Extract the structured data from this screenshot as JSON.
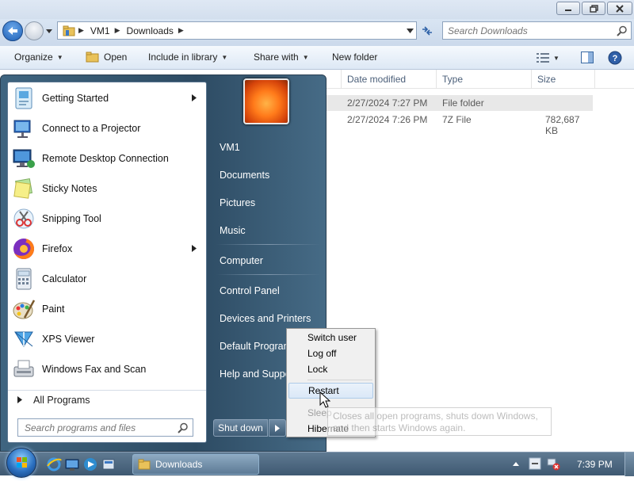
{
  "explorer": {
    "address": [
      "VM1",
      "Downloads"
    ],
    "search_placeholder": "Search Downloads",
    "toolbar": {
      "organize": "Organize",
      "open": "Open",
      "include": "Include in library",
      "share": "Share with",
      "new_folder": "New folder"
    },
    "columns": {
      "date": "Date modified",
      "type": "Type",
      "size": "Size"
    },
    "files": [
      {
        "date": "2/27/2024 7:27 PM",
        "type": "File folder",
        "size": ""
      },
      {
        "date": "2/27/2024 7:26 PM",
        "type": "7Z File",
        "size": "782,687 KB"
      }
    ]
  },
  "start_menu": {
    "programs": [
      {
        "label": "Getting Started",
        "icon": "getting-started-icon",
        "submenu": true
      },
      {
        "label": "Connect to a Projector",
        "icon": "projector-icon",
        "submenu": false
      },
      {
        "label": "Remote Desktop Connection",
        "icon": "remote-desktop-icon",
        "submenu": false
      },
      {
        "label": "Sticky Notes",
        "icon": "sticky-notes-icon",
        "submenu": false
      },
      {
        "label": "Snipping Tool",
        "icon": "snipping-tool-icon",
        "submenu": false
      },
      {
        "label": "Firefox",
        "icon": "firefox-icon",
        "submenu": true
      },
      {
        "label": "Calculator",
        "icon": "calculator-icon",
        "submenu": false
      },
      {
        "label": "Paint",
        "icon": "paint-icon",
        "submenu": false
      },
      {
        "label": "XPS Viewer",
        "icon": "xps-viewer-icon",
        "submenu": false
      },
      {
        "label": "Windows Fax and Scan",
        "icon": "fax-scan-icon",
        "submenu": false
      }
    ],
    "all_programs": "All Programs",
    "search_placeholder": "Search programs and files",
    "right_links": [
      "VM1",
      "Documents",
      "Pictures",
      "Music",
      "Computer",
      "Control Panel",
      "Devices and Printers",
      "Default Programs",
      "Help and Support"
    ],
    "shutdown": "Shut down"
  },
  "power_menu": {
    "items": [
      "Switch user",
      "Log off",
      "Lock",
      "Restart",
      "Sleep",
      "Hibernate"
    ],
    "selected": "Restart",
    "disabled": "Sleep",
    "tooltip": "Closes all open programs, shuts down Windows, and then starts Windows again."
  },
  "taskbar": {
    "window_button": "Downloads",
    "clock": "7:39 PM"
  },
  "colors": {
    "start_menu_bg": "#2d4b63",
    "taskbar_bg": "#4a657d",
    "selection": "#dbe8f7"
  }
}
